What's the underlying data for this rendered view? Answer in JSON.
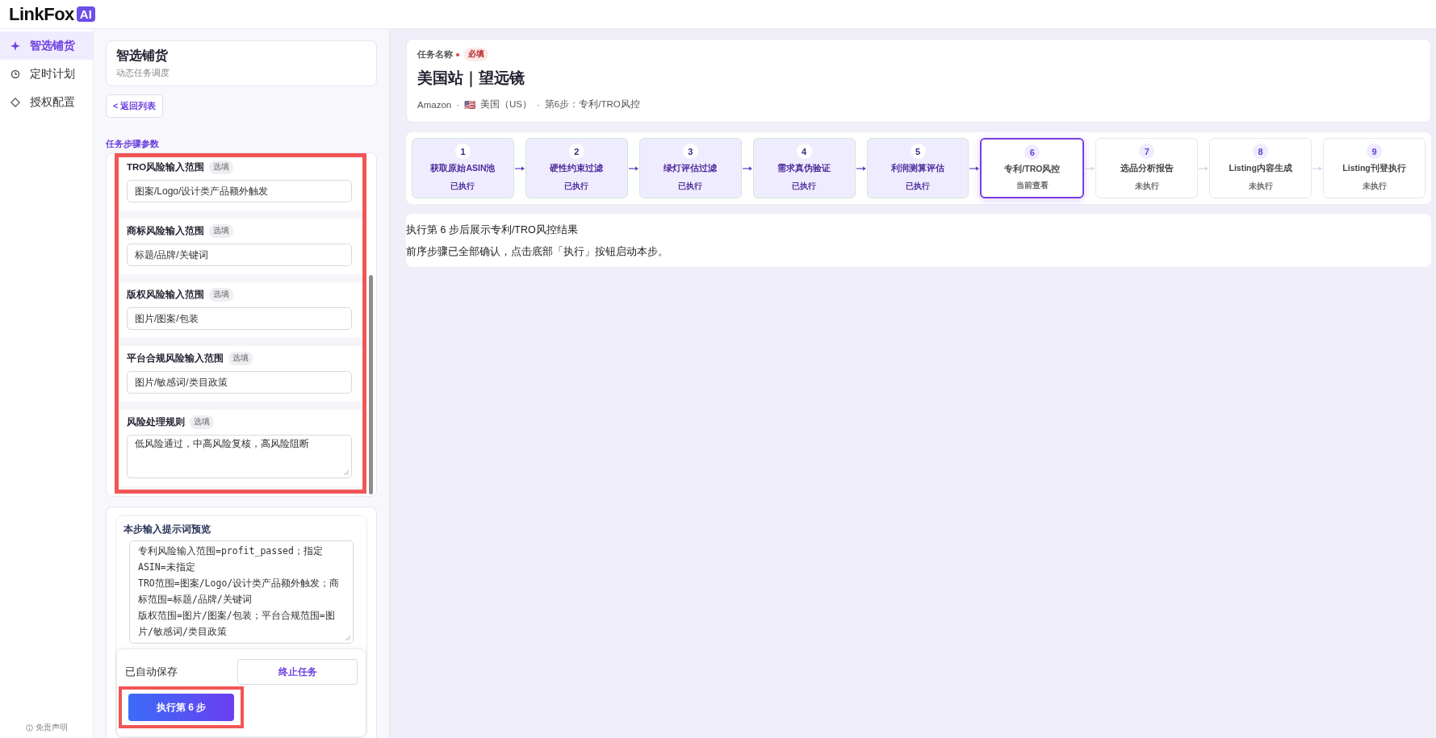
{
  "app": {
    "logo_text": "LinkFox",
    "logo_badge": "AI"
  },
  "sidebar": {
    "items": [
      {
        "label": "智选铺货",
        "selected": true
      },
      {
        "label": "定时计划",
        "selected": false
      },
      {
        "label": "授权配置",
        "selected": false
      }
    ],
    "footer": "免责声明"
  },
  "left_panel": {
    "title": "智选铺货",
    "subtitle": "动态任务调度",
    "back_button": "< 返回列表",
    "section_title": "任务步骤参数",
    "form": {
      "highlighted": true,
      "fields": [
        {
          "kind": "input",
          "label": "TRO风险输入范围",
          "tag": "选填",
          "value": "图案/Logo/设计类产品额外触发"
        },
        {
          "kind": "input",
          "label": "商标风险输入范围",
          "tag": "选填",
          "value": "标题/品牌/关键词"
        },
        {
          "kind": "input",
          "label": "版权风险输入范围",
          "tag": "选填",
          "value": "图片/图案/包装"
        },
        {
          "kind": "input",
          "label": "平台合规风险输入范围",
          "tag": "选填",
          "value": "图片/敏感词/类目政策"
        },
        {
          "kind": "textarea",
          "label": "风险处理规则",
          "tag": "选填",
          "value": "低风险通过，中高风险复核，高风险阻断"
        }
      ]
    },
    "prompt_preview": {
      "title": "本步输入提示词预览",
      "lines": [
        "专利风险输入范围=profit_passed；指定",
        "ASIN=未指定",
        "TRO范围=图案/Logo/设计类产品额外触发；商",
        "标范围=标题/品牌/关键词",
        "版权范围=图片/图案/包装；平台合规范围=图",
        "片/敏感词/类目政策"
      ]
    },
    "footer": {
      "status": "已自动保存",
      "stop_button": "终止任务",
      "run_button": {
        "label": "执行第 6 步",
        "highlighted": true
      }
    }
  },
  "task": {
    "label": "任务名称",
    "required_tag": "必填",
    "name": "美国站｜望远镜",
    "meta": [
      {
        "kind": "text",
        "text": "Amazon"
      },
      {
        "kind": "separator",
        "text": "·"
      },
      {
        "kind": "flag",
        "text": "🇺🇸"
      },
      {
        "kind": "text",
        "text": "美国（US）"
      },
      {
        "kind": "separator",
        "text": "·"
      },
      {
        "kind": "text",
        "text": "第6步：专利/TRO风控"
      }
    ]
  },
  "steps": [
    {
      "number": "1",
      "title": "获取原始ASIN池",
      "status": "已执行",
      "done": true,
      "selected": false
    },
    {
      "number": "2",
      "title": "硬性约束过滤",
      "status": "已执行",
      "done": true,
      "selected": false
    },
    {
      "number": "3",
      "title": "绿灯评估过滤",
      "status": "已执行",
      "done": true,
      "selected": false
    },
    {
      "number": "4",
      "title": "需求真伪验证",
      "status": "已执行",
      "done": true,
      "selected": false
    },
    {
      "number": "5",
      "title": "利润测算评估",
      "status": "已执行",
      "done": true,
      "selected": false
    },
    {
      "number": "6",
      "title": "专利/TRO风控",
      "status": "当前查看",
      "done": false,
      "selected": true
    },
    {
      "number": "7",
      "title": "选品分析报告",
      "status": "未执行",
      "done": false,
      "selected": false
    },
    {
      "number": "8",
      "title": "Listing内容生成",
      "status": "未执行",
      "done": false,
      "selected": false
    },
    {
      "number": "9",
      "title": "Listing刊登执行",
      "status": "未执行",
      "done": false,
      "selected": false
    }
  ],
  "result": {
    "title": "执行第 6 步后展示专利/TRO风控结果",
    "message": "前序步骤已全部确认，点击底部「执行」按钮启动本步。"
  }
}
